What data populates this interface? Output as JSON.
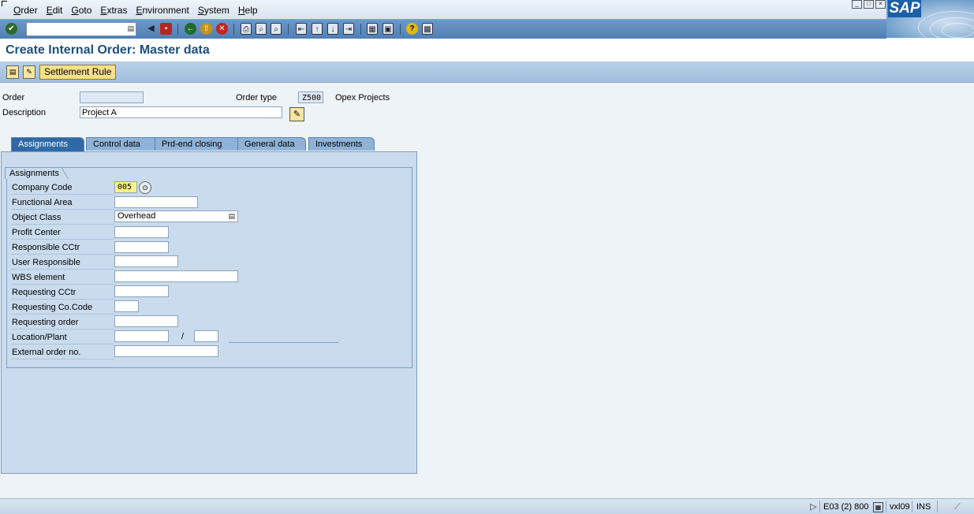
{
  "menu": [
    "Order",
    "Edit",
    "Goto",
    "Extras",
    "Environment",
    "System",
    "Help"
  ],
  "window_controls": [
    "_",
    "□",
    "×"
  ],
  "logo_text": "SAP",
  "toolbar": {
    "command_field_value": "",
    "icons": [
      "enter-icon",
      "command-dropdown-icon",
      "prev-icon",
      "save-icon",
      "back-icon",
      "exit-icon",
      "cancel-icon",
      "print-icon",
      "find-icon",
      "find-next-icon",
      "first-page-icon",
      "prev-page-icon",
      "next-page-icon",
      "last-page-icon",
      "new-session-icon",
      "shortcut-icon",
      "help-icon",
      "layout-icon"
    ]
  },
  "title": "Create Internal Order: Master data",
  "app_toolbar": {
    "settlement_rule": "Settlement Rule"
  },
  "header": {
    "order_label": "Order",
    "order_value": "",
    "order_type_label": "Order type",
    "order_type_value": "Z500",
    "order_type_desc": "Opex Projects",
    "description_label": "Description",
    "description_value": "Project A"
  },
  "tabs": [
    "Assignments",
    "Control data",
    "Prd-end closing",
    "General data",
    "Investments"
  ],
  "active_tab": "Assignments",
  "assignments": {
    "group_title": "Assignments",
    "rows": [
      {
        "label": "Company Code",
        "value": "005"
      },
      {
        "label": "Functional Area",
        "value": ""
      },
      {
        "label": "Object Class",
        "value": "Overhead"
      },
      {
        "label": "Profit Center",
        "value": ""
      },
      {
        "label": "Responsible CCtr",
        "value": ""
      },
      {
        "label": "User Responsible",
        "value": ""
      },
      {
        "label": "WBS element",
        "value": ""
      },
      {
        "label": "Requesting CCtr",
        "value": ""
      },
      {
        "label": "Requesting Co.Code",
        "value": ""
      },
      {
        "label": "Requesting order",
        "value": ""
      },
      {
        "label": "Location/Plant",
        "value": "",
        "value2": ""
      },
      {
        "label": "External order no.",
        "value": ""
      }
    ],
    "location_separator": "/"
  },
  "status": {
    "system": "E03 (2) 800",
    "server": "vxl09",
    "mode": "INS"
  },
  "colors": {
    "title": "#1d4f7e",
    "active_tab": "#2f6aa6",
    "panel": "#c9dbed",
    "focus_field": "#fff38a",
    "toolbar": "#4f7fb5"
  }
}
